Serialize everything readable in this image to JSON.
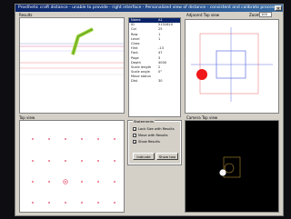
{
  "window": {
    "title": "Prosthetic craft distance - unable to provide - right interface - Personalized view of distance - consistent and calibrate process",
    "close_glyph": "×"
  },
  "panels": {
    "top_left_label": "Results",
    "bottom_left_label": "Top view",
    "top_right_label": "Adjacent Top view",
    "bottom_right_label": "Camera Top view"
  },
  "zoom": {
    "label": "Zoom",
    "value": "100"
  },
  "properties": [
    {
      "key": "Name",
      "value": "A1"
    },
    {
      "key": "ID",
      "value": "5152620"
    },
    {
      "key": "Col",
      "value": "25"
    },
    {
      "key": "Row",
      "value": "1"
    },
    {
      "key": "Level",
      "value": "1"
    },
    {
      "key": "Class",
      "value": ""
    },
    {
      "key": "Hint",
      "value": "-13"
    },
    {
      "key": "Font",
      "value": "47"
    },
    {
      "key": "Page",
      "value": "3"
    },
    {
      "key": "Depth",
      "value": "4000"
    },
    {
      "key": "Scale length",
      "value": "2"
    },
    {
      "key": "Scale angle",
      "value": "0°"
    },
    {
      "key": "Move status",
      "value": ""
    },
    {
      "key": "Dist",
      "value": "30"
    }
  ],
  "options": {
    "title": "Statements",
    "items": [
      {
        "label": "Lock Size with Results",
        "checked": "✓"
      },
      {
        "label": "Move with Results",
        "checked": ""
      },
      {
        "label": "Show Results",
        "checked": "✓"
      }
    ],
    "left_button": "Indicate",
    "right_button": "Show two"
  }
}
